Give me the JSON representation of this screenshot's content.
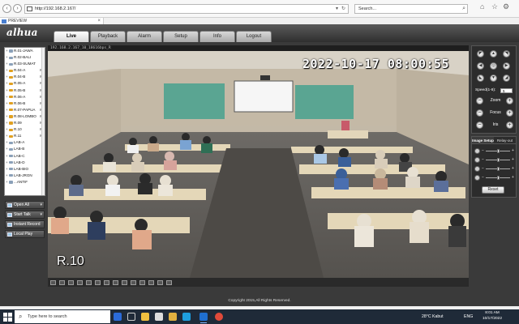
{
  "browser": {
    "url": "http://192.168.2.167/",
    "search_placeholder": "Search...",
    "tab_title": "PREVIEW"
  },
  "app": {
    "logo": "alhua",
    "nav": [
      "Live",
      "Playback",
      "Alarm",
      "Setup",
      "Info",
      "Logout"
    ],
    "active_nav": "Live"
  },
  "channels": [
    {
      "label": "R.01-JAWA",
      "active": false,
      "mark": ""
    },
    {
      "label": "R.02-BALI",
      "active": false,
      "mark": ""
    },
    {
      "label": "R.03-SUMAT",
      "active": false,
      "mark": ""
    },
    {
      "label": "R.04-A",
      "active": true,
      "mark": "M"
    },
    {
      "label": "R.04-B",
      "active": true,
      "mark": "M"
    },
    {
      "label": "R.05-A",
      "active": true,
      "mark": "M"
    },
    {
      "label": "R.05-B",
      "active": true,
      "mark": "M"
    },
    {
      "label": "R.06-A",
      "active": true,
      "mark": "M"
    },
    {
      "label": "R.06-B",
      "active": true,
      "mark": "M"
    },
    {
      "label": "R.07-PAPUA",
      "active": true,
      "mark": "M"
    },
    {
      "label": "R.08-LOMBO",
      "active": true,
      "mark": "M"
    },
    {
      "label": "R.09",
      "active": true,
      "mark": "M"
    },
    {
      "label": "R.10",
      "active": true,
      "mark": "M"
    },
    {
      "label": "R.11",
      "active": true,
      "mark": "M"
    },
    {
      "label": "LAB-A",
      "active": false,
      "mark": ""
    },
    {
      "label": "LAB-B",
      "active": false,
      "mark": ""
    },
    {
      "label": "LAB-C",
      "active": false,
      "mark": ""
    },
    {
      "label": "LAB-D",
      "active": false,
      "mark": ""
    },
    {
      "label": "LAB-BIO",
      "active": false,
      "mark": ""
    },
    {
      "label": "LAB-JRGN",
      "active": false,
      "mark": ""
    },
    {
      "label": "...ANTIF",
      "active": false,
      "mark": ""
    }
  ],
  "side_buttons": {
    "open_all": "Open All",
    "start_talk": "Start Talk",
    "instant_record": "Instant Record",
    "local_play": "Local Play"
  },
  "video": {
    "header": "192.168.2.167_10_18616bps_R",
    "timestamp": "2022-10-17 08:00:55",
    "channel_name": "R.10"
  },
  "ptz": {
    "speed_label": "Speed(1-8):",
    "speed_value": "5",
    "zoom": "Zoom",
    "focus": "Focus",
    "iris": "Iris"
  },
  "image_setup": {
    "tabs": [
      "Image Setup",
      "Relay-out"
    ],
    "levels": [
      0.5,
      0.5,
      0.5,
      0.5
    ],
    "reset": "Reset"
  },
  "footer": "Copyright 2015,All Rights Reserved.",
  "taskbar": {
    "search_placeholder": "Type here to search",
    "weather": "28°C  Kabut",
    "lang": "ENG",
    "time": "8:01 AM",
    "date": "10/17/2022"
  }
}
